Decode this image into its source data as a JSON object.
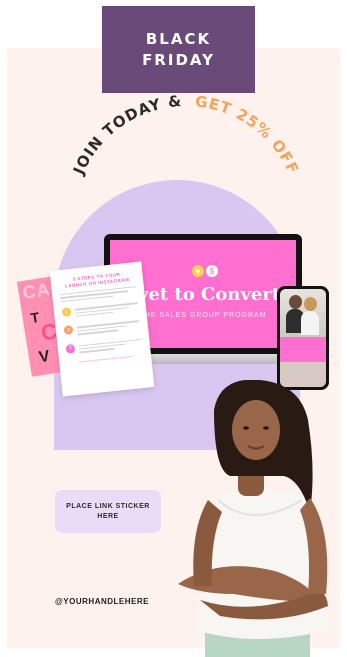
{
  "badge": {
    "line1": "BLACK",
    "line2": "FRIDAY"
  },
  "headline": {
    "part1": "JOIN TODAY &",
    "part2": "GET 25% OFF"
  },
  "laptop": {
    "title": "ovet to Convert",
    "subtitle": "THE SALES GROUP PROGRAM"
  },
  "doc": {
    "title_line1": "3 STEPS TO YOUR",
    "title_line2": "LAUNCH ON INSTAGRAM",
    "steps": [
      "1",
      "2",
      "3"
    ]
  },
  "cta": {
    "link_sticker": "PLACE LINK STICKER HERE"
  },
  "handle": "@YOURHANDLEHERE",
  "colors": {
    "badge_bg": "#6a4a78",
    "card_bg": "#fdf2ee",
    "arch": "#d9c7f2",
    "headline_dark": "#2b2b2b",
    "headline_accent": "#f5a25a",
    "laptop_screen": "#ff6fcf",
    "link_box": "#eadcf7"
  }
}
